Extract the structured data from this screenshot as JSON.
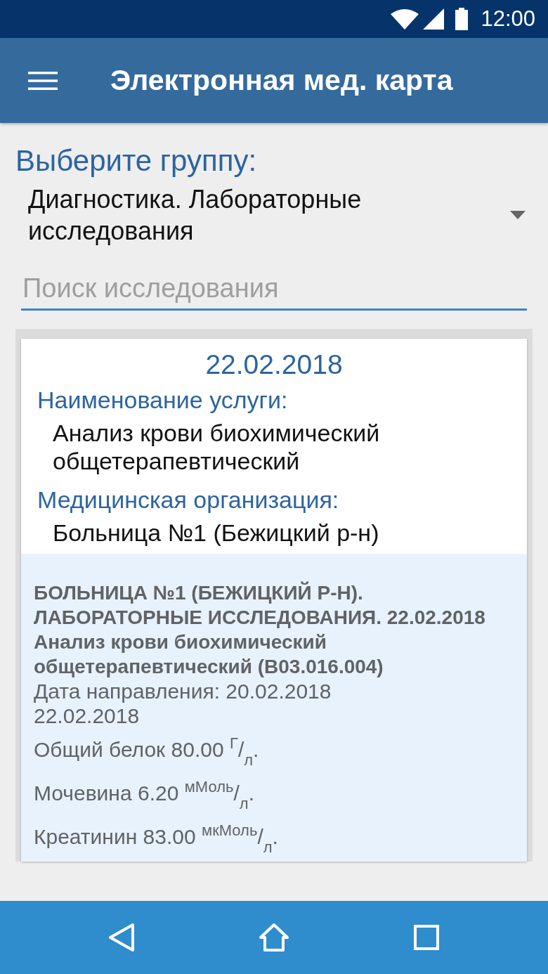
{
  "status_bar": {
    "time": "12:00"
  },
  "app_bar": {
    "title": "Электронная мед. карта"
  },
  "group_select": {
    "label": "Выберите группу:",
    "value": "Диагностика. Лабораторные исследования"
  },
  "search": {
    "placeholder": "Поиск исследования"
  },
  "record": {
    "date": "22.02.2018",
    "fields": [
      {
        "label": "Наименование услуги:",
        "value": "Анализ крови биохимический общетерапевтический"
      },
      {
        "label": "Медицинская организация:",
        "value": "Больница №1 (Бежицкий р-н)"
      }
    ],
    "details": {
      "header": "БОЛЬНИЦА №1 (БЕЖИЦКИЙ Р-Н). ЛАБОРАТОРНЫЕ ИССЛЕДОВАНИЯ. 22.02.2018",
      "service": "Анализ крови биохимический общетерапевтический (В03.016.004)",
      "referral": "Дата направления: 20.02.2018",
      "result_date": "22.02.2018",
      "results": [
        "Общий белок 80.00 $^{Г}$/$_{л}$.",
        "Мочевина 6.20 $^{мМоль}$/$_{л}$.",
        "Креатинин 83.00 $^{мкМоль}$/$_{л}$."
      ]
    }
  }
}
